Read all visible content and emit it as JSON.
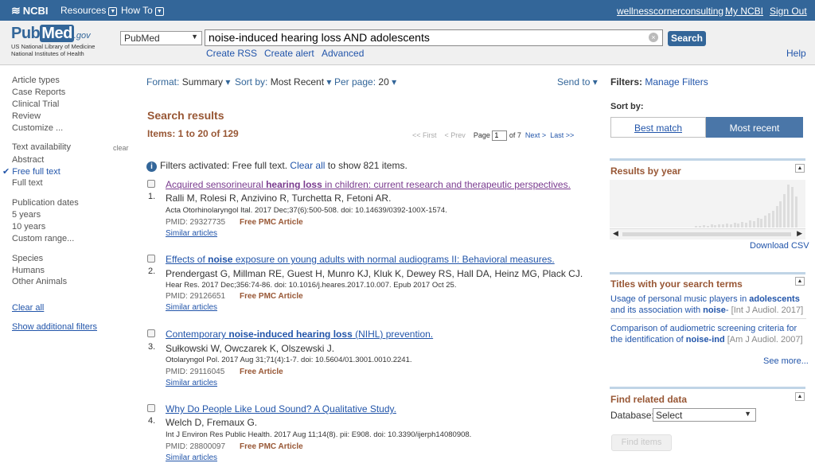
{
  "topbar": {
    "ncbi": "NCBI",
    "resources": "Resources",
    "howto": "How To",
    "user": "wellnesscornerconsulting",
    "myncbi": "My NCBI",
    "signout": "Sign Out"
  },
  "header": {
    "logo_pub": "Pub",
    "logo_med": "Med",
    "logo_gov": ".gov",
    "logo_sub1": "US National Library of Medicine",
    "logo_sub2": "National Institutes of Health",
    "db_value": "PubMed",
    "query": "noise-induced hearing loss AND adolescents",
    "search_label": "Search",
    "create_rss": "Create RSS",
    "create_alert": "Create alert",
    "advanced": "Advanced",
    "help": "Help"
  },
  "sidebar": {
    "article_types": "Article types",
    "case_reports": "Case Reports",
    "clinical_trial": "Clinical Trial",
    "review": "Review",
    "customize": "Customize ...",
    "text_availability": "Text availability",
    "clear": "clear",
    "abstract": "Abstract",
    "free_full_text": "Free full text",
    "full_text": "Full text",
    "publication_dates": "Publication dates",
    "five_years": "5 years",
    "ten_years": "10 years",
    "custom_range": "Custom range...",
    "species": "Species",
    "humans": "Humans",
    "other_animals": "Other Animals",
    "clear_all": "Clear all",
    "show_additional": "Show additional filters"
  },
  "toolbar": {
    "format_label": "Format:",
    "format_value": "Summary",
    "sortby_label": "Sort by:",
    "sortby_value": "Most Recent",
    "perpage_label": "Per page:",
    "perpage_value": "20",
    "sendto": "Send to"
  },
  "results": {
    "title": "Search results",
    "items": "Items: 1 to 20 of 129",
    "pager": {
      "first": "<< First",
      "prev": "< Prev",
      "page_label": "Page",
      "page_value": "1",
      "of": "of 7",
      "next": "Next >",
      "last": "Last >>"
    },
    "filters_msg": "Filters activated: Free full text.",
    "filters_clear": "Clear all",
    "filters_show": "to show 821 items.",
    "list": [
      {
        "num": "1.",
        "title_pre": "Acquired sensorineural ",
        "title_bold": "hearing loss",
        "title_post": " in children: current research and therapeutic perspectives.",
        "authors": "Ralli M, Rolesi R, Anzivino R, Turchetta R, Fetoni AR.",
        "journal": "Acta Otorhinolaryngol Ital. 2017 Dec;37(6):500-508. doi: 10.14639/0392-100X-1574.",
        "pmid": "PMID: 29327735",
        "free": "Free PMC Article",
        "similar": "Similar articles"
      },
      {
        "num": "2.",
        "title_pre": "Effects of ",
        "title_bold": "noise",
        "title_post": " exposure on young adults with normal audiograms II: Behavioral measures.",
        "authors": "Prendergast G, Millman RE, Guest H, Munro KJ, Kluk K, Dewey RS, Hall DA, Heinz MG, Plack CJ.",
        "journal": "Hear Res. 2017 Dec;356:74-86. doi: 10.1016/j.heares.2017.10.007. Epub 2017 Oct 25.",
        "pmid": "PMID: 29126651",
        "free": "Free PMC Article",
        "similar": "Similar articles"
      },
      {
        "num": "3.",
        "title_pre": "Contemporary ",
        "title_bold": "noise-induced hearing loss",
        "title_post": " (NIHL) prevention.",
        "authors": "Sułkowski W, Owczarek K, Olszewski J.",
        "journal": "Otolaryngol Pol. 2017 Aug 31;71(4):1-7. doi: 10.5604/01.3001.0010.2241.",
        "pmid": "PMID: 29116045",
        "free": "Free Article",
        "similar": "Similar articles"
      },
      {
        "num": "4.",
        "title_pre": "Why Do People Like Loud Sound? A Qualitative Study.",
        "title_bold": "",
        "title_post": "",
        "authors": "Welch D, Fremaux G.",
        "journal": "Int J Environ Res Public Health. 2017 Aug 11;14(8). pii: E908. doi: 10.3390/ijerph14080908.",
        "pmid": "PMID: 28800097",
        "free": "Free PMC Article",
        "similar": "Similar articles"
      }
    ]
  },
  "right": {
    "filters_label": "Filters:",
    "manage_filters": "Manage Filters",
    "sortby": "Sort by:",
    "best_match": "Best match",
    "most_recent": "Most recent",
    "results_by_year": "Results by year",
    "download_csv": "Download CSV",
    "year_bar_levels": [
      0.04,
      0.04,
      0.05,
      0.04,
      0.06,
      0.05,
      0.07,
      0.06,
      0.08,
      0.07,
      0.1,
      0.09,
      0.12,
      0.1,
      0.15,
      0.14,
      0.2,
      0.18,
      0.25,
      0.3,
      0.35,
      0.45,
      0.55,
      0.7,
      0.9,
      0.85,
      0.65
    ],
    "titles_header": "Titles with your search terms",
    "titles": [
      {
        "pre": "Usage of personal music players in ",
        "b1": "adolescents",
        "mid": " and its association with ",
        "b2": "noise",
        "post": "-",
        "jr": " [Int J Audiol. 2017]"
      },
      {
        "pre": "Comparison of audiometric screening criteria for the identification of ",
        "b1": "noise-ind",
        "mid": "",
        "b2": "",
        "post": "",
        "jr": " [Am J Audiol. 2007]"
      }
    ],
    "see_more": "See more...",
    "find_related": "Find related data",
    "database_label": "Database:",
    "database_value": "Select",
    "find_items": "Find items"
  }
}
